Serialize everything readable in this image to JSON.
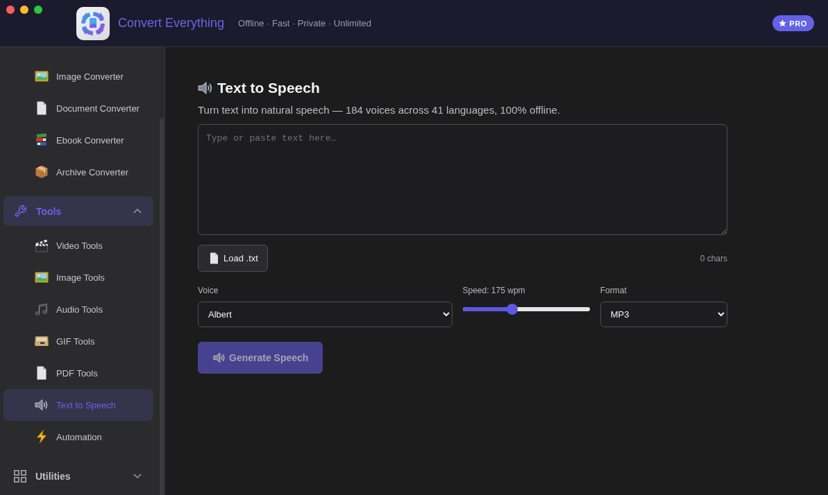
{
  "window": {
    "title": "Convert Everything",
    "tagline": "Offline · Fast · Private · Unlimited",
    "badge": "PRO"
  },
  "sidebar": {
    "items": [
      {
        "label": "Image Converter",
        "selected": false
      },
      {
        "label": "Document Converter",
        "selected": false
      },
      {
        "label": "Ebook Converter",
        "selected": false
      },
      {
        "label": "Archive Converter",
        "selected": false
      }
    ],
    "groups": [
      {
        "label": "Tools",
        "expanded": true,
        "active": true,
        "children": [
          {
            "label": "Video Tools",
            "selected": false
          },
          {
            "label": "Image Tools",
            "selected": false
          },
          {
            "label": "Audio Tools",
            "selected": false
          },
          {
            "label": "GIF Tools",
            "selected": false
          },
          {
            "label": "PDF Tools",
            "selected": false
          },
          {
            "label": "Text to Speech",
            "selected": true
          },
          {
            "label": "Automation",
            "selected": false
          }
        ]
      },
      {
        "label": "Utilities",
        "expanded": false,
        "active": false
      }
    ]
  },
  "main": {
    "title": "Text to Speech",
    "subtitle": "Turn text into natural speech — 184 voices across 41 languages, 100% offline.",
    "text_input": {
      "placeholder": "Type or paste text here…"
    },
    "load_button": "Load .txt",
    "char_count": "0 chars",
    "voice": {
      "label": "Voice",
      "value": "Albert"
    },
    "speed": {
      "label": "Speed: 175 wpm",
      "level": 0.38
    },
    "format": {
      "label": "Format",
      "value": "MP3"
    },
    "generate_button": {
      "label": "Generate Speech",
      "disabled": true
    }
  }
}
